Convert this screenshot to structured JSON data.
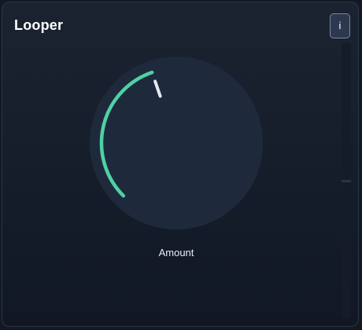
{
  "header": {
    "title": "Looper",
    "info_label": "i"
  },
  "knob": {
    "label": "Amount",
    "value_fraction": 0.43,
    "arc_color": "#4fd1a5",
    "body_color": "#1e2a3c",
    "pointer_color": "#e6e9ef"
  },
  "icons": {
    "info": "info-icon"
  }
}
